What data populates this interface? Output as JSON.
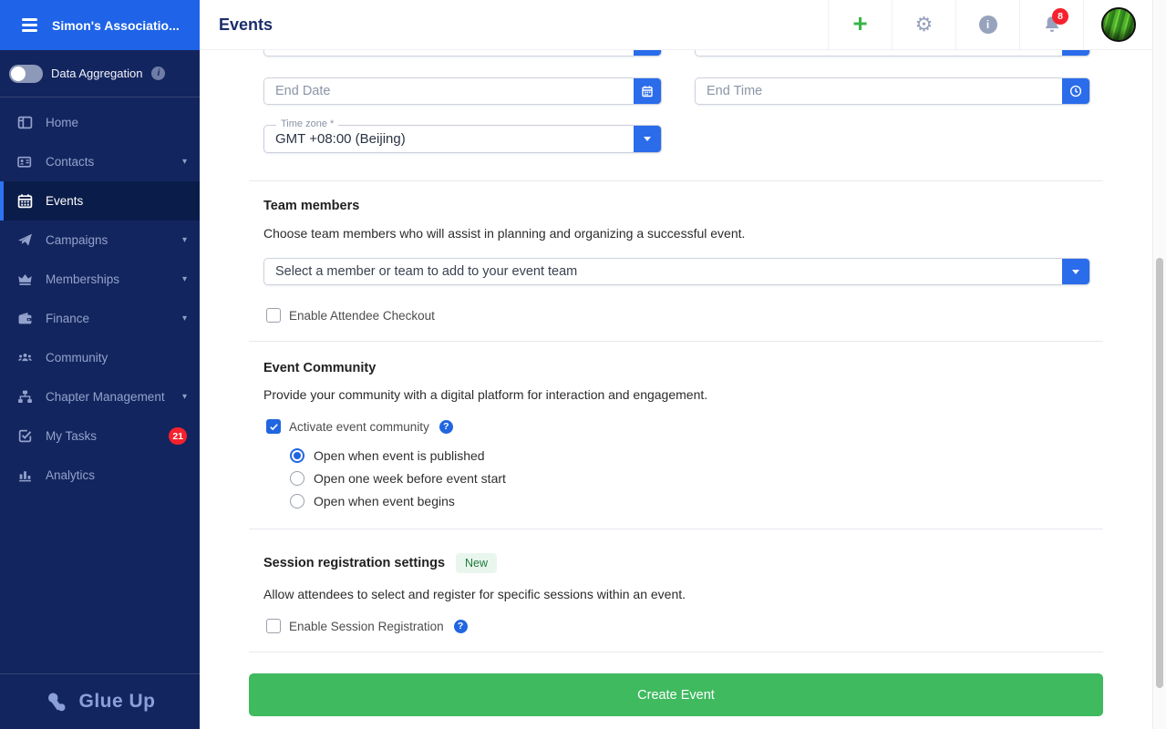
{
  "sidebar": {
    "org_name": "Simon's Associatio...",
    "aggregation_label": "Data Aggregation",
    "items": [
      {
        "label": "Home"
      },
      {
        "label": "Contacts"
      },
      {
        "label": "Events"
      },
      {
        "label": "Campaigns"
      },
      {
        "label": "Memberships"
      },
      {
        "label": "Finance"
      },
      {
        "label": "Community"
      },
      {
        "label": "Chapter Management"
      },
      {
        "label": "My Tasks",
        "badge": "21"
      },
      {
        "label": "Analytics"
      }
    ],
    "logo_text": "Glue Up"
  },
  "header": {
    "title": "Events",
    "notification_count": "8"
  },
  "form": {
    "end_date": {
      "placeholder": "End Date"
    },
    "end_time": {
      "placeholder": "End Time"
    },
    "timezone": {
      "label": "Time zone *",
      "value": "GMT +08:00 (Beijing)"
    },
    "team": {
      "heading": "Team members",
      "description": "Choose team members who will assist in planning and organizing a successful event.",
      "select_placeholder": "Select a member or team to add to your event team",
      "checkbox_label": "Enable Attendee Checkout"
    },
    "community": {
      "heading": "Event Community",
      "description": "Provide your community with a digital platform for interaction and engagement.",
      "checkbox_label": "Activate event community",
      "options": [
        "Open when event is published",
        "Open one week before event start",
        "Open when event begins"
      ],
      "selected_option": "Open when event is published"
    },
    "session": {
      "heading": "Session registration settings",
      "badge": "New",
      "description": "Allow attendees to select and register for specific sessions within an event.",
      "checkbox_label": "Enable Session Registration"
    },
    "submit_label": "Create Event"
  },
  "colors": {
    "accent_blue": "#2a6cea",
    "sidebar_navy": "#13255e",
    "sidebar_header_blue": "#1e63e8",
    "success_green": "#3fba5f",
    "badge_red": "#f5222d"
  }
}
